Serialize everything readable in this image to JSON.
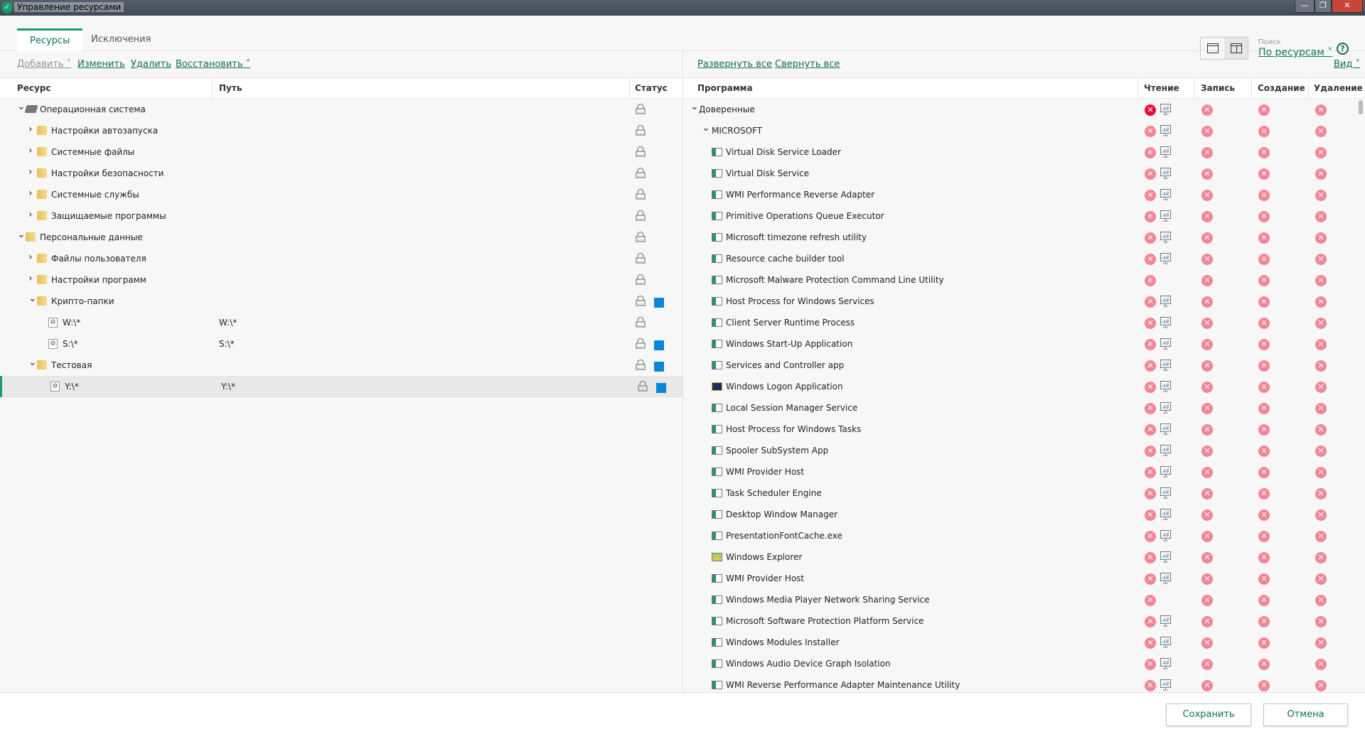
{
  "window": {
    "title": "Управление ресурсами",
    "min": "—",
    "max": "❐",
    "close": "✕"
  },
  "tabs": [
    {
      "label": "Ресурсы",
      "active": true
    },
    {
      "label": "Исключения",
      "active": false
    }
  ],
  "search": {
    "label": "Поиск",
    "value": "По ресурсам ˅"
  },
  "help": "?",
  "left_toolbar": {
    "add": "Добавить ˅",
    "edit": "Изменить",
    "delete": "Удалить",
    "restore": "Восстановить ˅"
  },
  "right_toolbar": {
    "expand_all": "Развернуть все",
    "collapse_all": "Свернуть все",
    "view": "Вид ˅"
  },
  "left_table": {
    "columns": [
      "Ресурс",
      "Путь",
      "Статус"
    ],
    "rows": [
      {
        "level": 0,
        "expanded": true,
        "icon": "chip",
        "name": "Операционная система",
        "path": "",
        "lock": true,
        "flag": false
      },
      {
        "level": 1,
        "expanded": false,
        "icon": "folder",
        "name": "Настройки автозапуска",
        "path": "",
        "lock": true,
        "flag": false
      },
      {
        "level": 1,
        "expanded": false,
        "icon": "folder",
        "name": "Системные файлы",
        "path": "",
        "lock": true,
        "flag": false
      },
      {
        "level": 1,
        "expanded": false,
        "icon": "folder",
        "name": "Настройки безопасности",
        "path": "",
        "lock": true,
        "flag": false
      },
      {
        "level": 1,
        "expanded": false,
        "icon": "folder",
        "name": "Системные службы",
        "path": "",
        "lock": true,
        "flag": false
      },
      {
        "level": 1,
        "expanded": false,
        "icon": "folder",
        "name": "Защищаемые программы",
        "path": "",
        "lock": true,
        "flag": false
      },
      {
        "level": 0,
        "expanded": true,
        "icon": "folder",
        "name": "Персональные данные",
        "path": "",
        "lock": true,
        "flag": false
      },
      {
        "level": 1,
        "expanded": false,
        "icon": "folder",
        "name": "Файлы пользователя",
        "path": "",
        "lock": true,
        "flag": false
      },
      {
        "level": 1,
        "expanded": false,
        "icon": "folder",
        "name": "Настройки программ",
        "path": "",
        "lock": true,
        "flag": false
      },
      {
        "level": 1,
        "expanded": true,
        "icon": "folder",
        "name": "Крипто-папки",
        "path": "",
        "lock": true,
        "flag": true
      },
      {
        "level": 2,
        "icon": "file",
        "name": "W:\\*",
        "path": "W:\\*",
        "lock": true,
        "flag": false
      },
      {
        "level": 2,
        "icon": "file",
        "name": "S:\\*",
        "path": "S:\\*",
        "lock": true,
        "flag": true
      },
      {
        "level": 1,
        "expanded": true,
        "icon": "folder",
        "name": "Тестовая",
        "path": "",
        "lock": true,
        "flag": true
      },
      {
        "level": 2,
        "icon": "file",
        "name": "Y:\\*",
        "path": "Y:\\*",
        "lock": true,
        "flag": true,
        "selected": true
      }
    ]
  },
  "right_table": {
    "columns": [
      "Программа",
      "Чтение",
      "Запись",
      "Создание",
      "Удаление"
    ],
    "groups": [
      {
        "label": "Доверенные"
      },
      {
        "label": "MICROSOFT"
      }
    ],
    "programs": [
      {
        "name": "Virtual Disk Service Loader",
        "monitor": true
      },
      {
        "name": "Virtual Disk Service",
        "monitor": true
      },
      {
        "name": "WMI Performance Reverse Adapter",
        "monitor": true
      },
      {
        "name": "Primitive Operations Queue Executor",
        "monitor": true
      },
      {
        "name": "Microsoft timezone refresh utility",
        "monitor": true
      },
      {
        "name": "Resource cache builder tool",
        "monitor": true
      },
      {
        "name": "Microsoft Malware Protection Command Line Utility",
        "monitor": false
      },
      {
        "name": "Host Process for Windows Services",
        "monitor": true
      },
      {
        "name": "Client Server Runtime Process",
        "monitor": true
      },
      {
        "name": "Windows Start-Up Application",
        "monitor": true
      },
      {
        "name": "Services and Controller app",
        "monitor": true
      },
      {
        "name": "Windows Logon Application",
        "monitor": true,
        "icon": "logon"
      },
      {
        "name": "Local Session Manager Service",
        "monitor": true
      },
      {
        "name": "Host Process for Windows Tasks",
        "monitor": true
      },
      {
        "name": "Spooler SubSystem App",
        "monitor": true
      },
      {
        "name": "WMI Provider Host",
        "monitor": true
      },
      {
        "name": "Task Scheduler Engine",
        "monitor": true
      },
      {
        "name": "Desktop Window Manager",
        "monitor": true
      },
      {
        "name": "PresentationFontCache.exe",
        "monitor": true
      },
      {
        "name": "Windows Explorer",
        "monitor": true,
        "icon": "explorer"
      },
      {
        "name": "WMI Provider Host",
        "monitor": true
      },
      {
        "name": "Windows Media Player Network Sharing Service",
        "monitor": false
      },
      {
        "name": "Microsoft Software Protection Platform Service",
        "monitor": true
      },
      {
        "name": "Windows Modules Installer",
        "monitor": true
      },
      {
        "name": "Windows Audio Device Graph Isolation",
        "monitor": true
      },
      {
        "name": "WMI Reverse Performance Adapter Maintenance Utility",
        "monitor": true
      }
    ]
  },
  "footer": {
    "save": "Сохранить",
    "cancel": "Отмена"
  },
  "colors": {
    "accent": "#1a9b73",
    "deny": "#f28597",
    "deny_strong": "#e6103c",
    "flag": "#0a86d8"
  }
}
